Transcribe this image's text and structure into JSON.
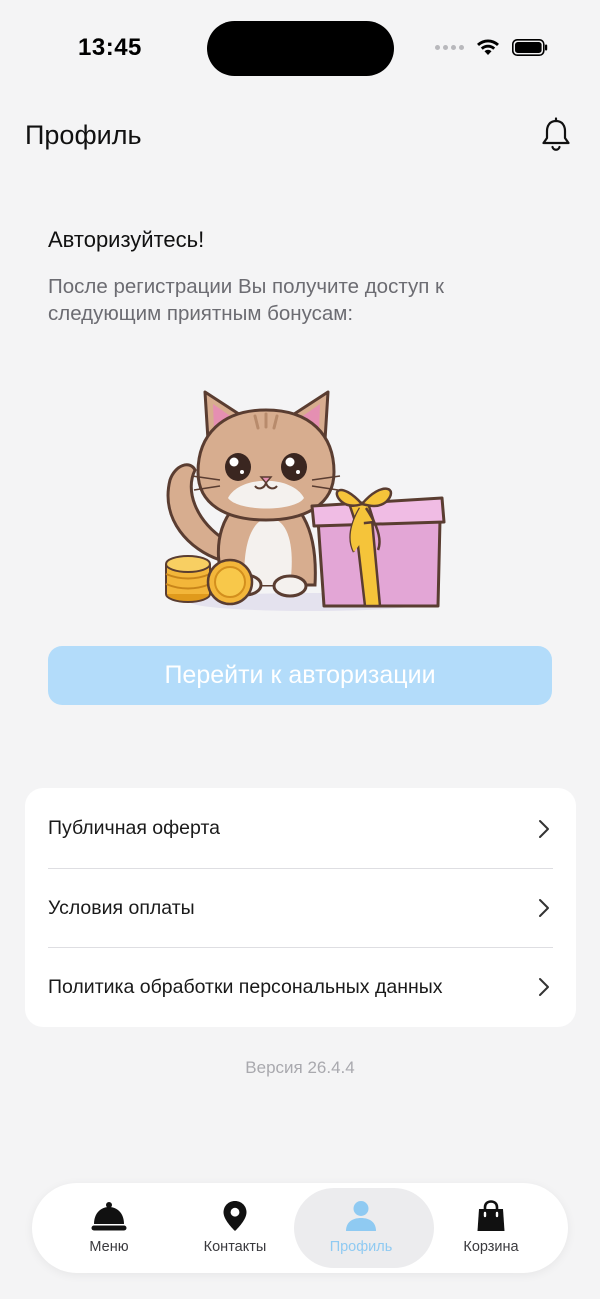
{
  "status_bar": {
    "time": "13:45"
  },
  "header": {
    "title": "Профиль",
    "bell_icon": "bell-icon"
  },
  "intro": {
    "title": "Авторизуйтесь!",
    "text": "После регистрации Вы получите доступ к следующим приятным бонусам:"
  },
  "auth_button": {
    "label": "Перейти к авторизации",
    "color": "#b3dcfa"
  },
  "links": [
    {
      "label": "Публичная оферта",
      "icon": "chevron-right-icon"
    },
    {
      "label": "Условия оплаты",
      "icon": "chevron-right-icon"
    },
    {
      "label": "Политика обработки персональных данных",
      "icon": "chevron-right-icon"
    }
  ],
  "version": "Версия 26.4.4",
  "tab_bar": {
    "active": "Профиль",
    "accent": "#8fcaf2",
    "tabs": [
      {
        "label": "Меню",
        "icon": "cloche-icon"
      },
      {
        "label": "Контакты",
        "icon": "map-pin-icon"
      },
      {
        "label": "Профиль",
        "icon": "person-icon"
      },
      {
        "label": "Корзина",
        "icon": "shopping-bag-icon"
      }
    ]
  }
}
